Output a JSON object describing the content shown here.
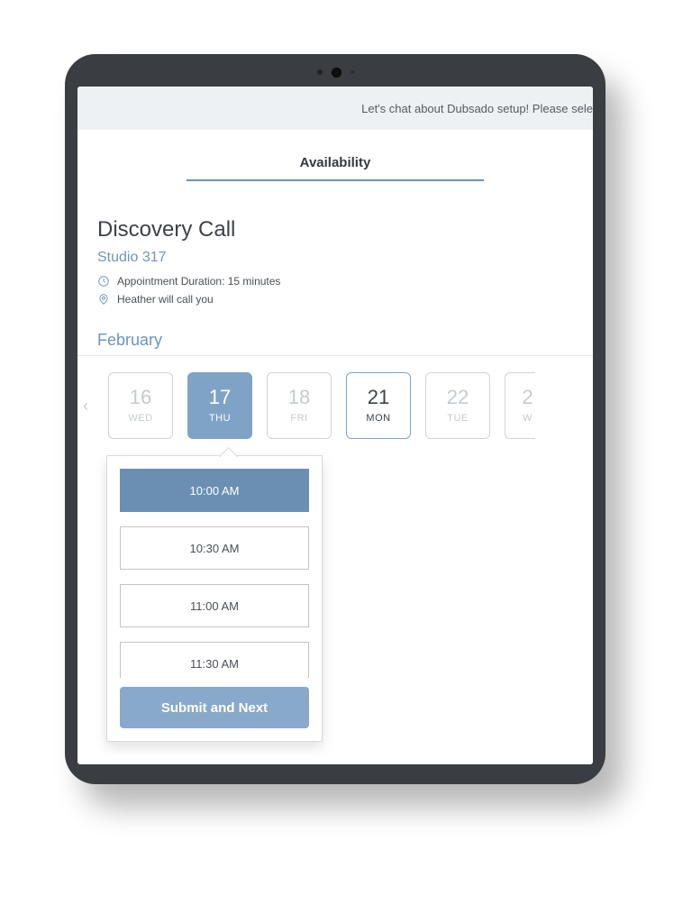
{
  "header": {
    "banner": "Let's chat about Dubsado setup! Please sele"
  },
  "tab": {
    "label": "Availability"
  },
  "appointment": {
    "title": "Discovery Call",
    "host": "Studio 317",
    "duration_text": "Appointment Duration: 15 minutes",
    "location_text": "Heather will call you"
  },
  "calendar": {
    "month": "February",
    "days": [
      {
        "num": "16",
        "dow": "WED",
        "state": "disabled"
      },
      {
        "num": "17",
        "dow": "THU",
        "state": "selected"
      },
      {
        "num": "18",
        "dow": "FRI",
        "state": "disabled"
      },
      {
        "num": "21",
        "dow": "MON",
        "state": "outlined"
      },
      {
        "num": "22",
        "dow": "TUE",
        "state": "disabled"
      },
      {
        "num": "2",
        "dow": "W",
        "state": "peek"
      }
    ]
  },
  "times": {
    "slots": [
      {
        "label": "10:00 AM",
        "selected": true
      },
      {
        "label": "10:30 AM",
        "selected": false
      },
      {
        "label": "11:00 AM",
        "selected": false
      },
      {
        "label": "11:30 AM",
        "selected": false
      }
    ],
    "submit_label": "Submit and Next"
  }
}
